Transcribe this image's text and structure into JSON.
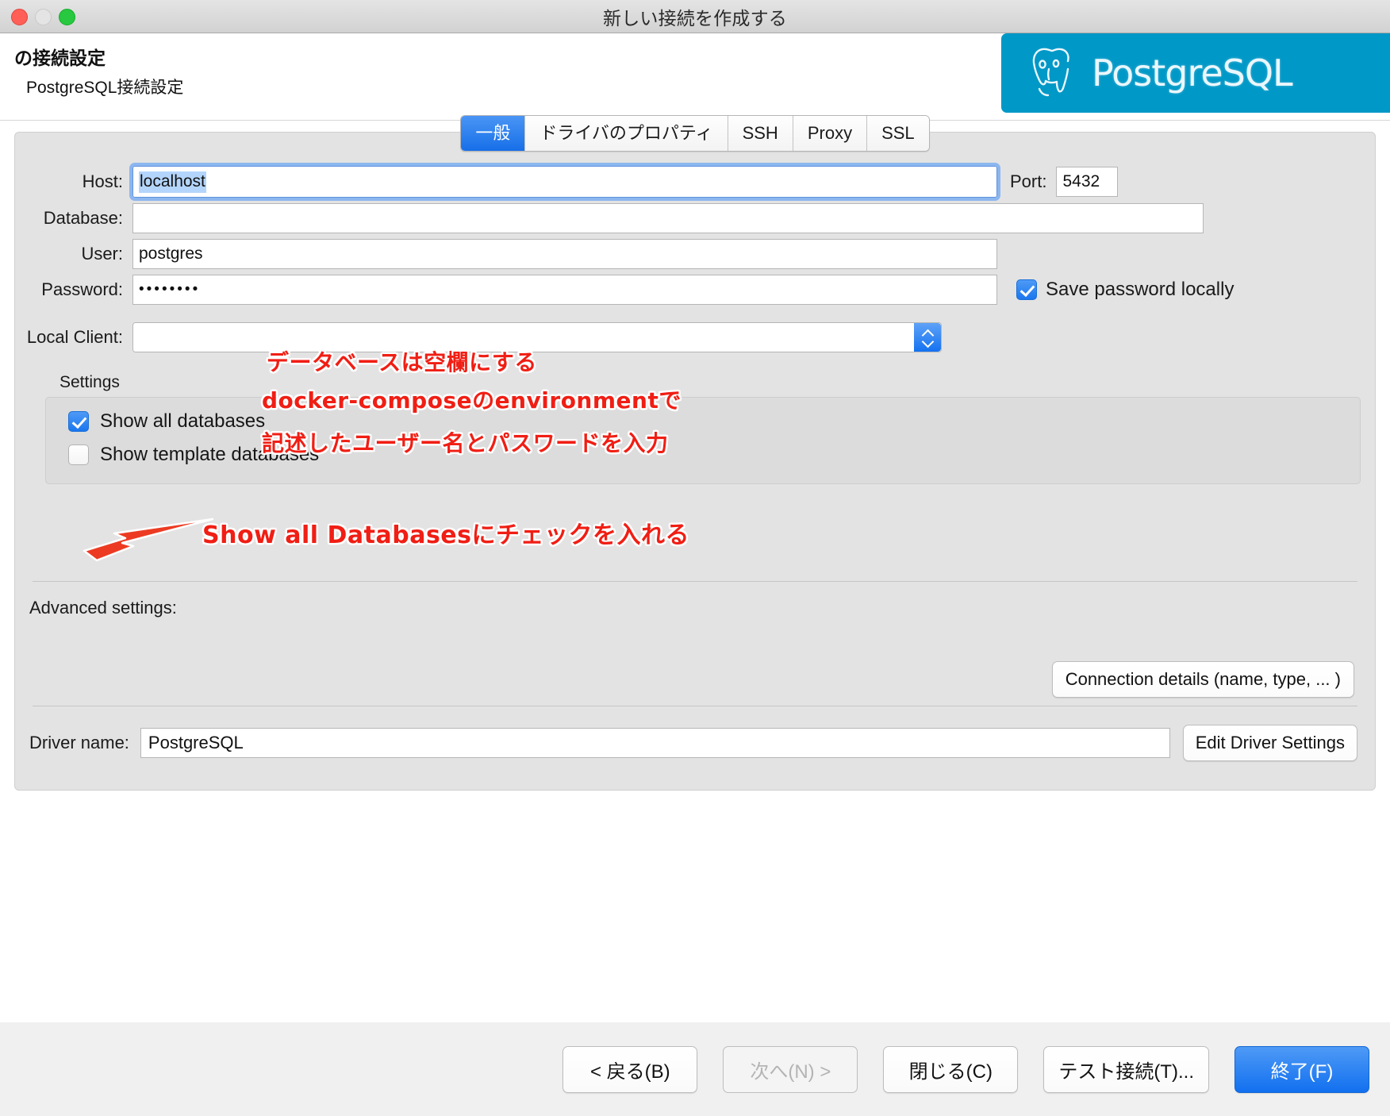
{
  "window": {
    "title": "新しい接続を作成する",
    "traffic_lights": [
      "close",
      "minimize",
      "maximize"
    ]
  },
  "header": {
    "title": "の接続設定",
    "subtitle": "PostgreSQL接続設定",
    "brand": "PostgreSQL",
    "brand_color": "#0098c7"
  },
  "tabs": [
    {
      "label": "一般",
      "active": true
    },
    {
      "label": "ドライバのプロパティ",
      "active": false
    },
    {
      "label": "SSH",
      "active": false
    },
    {
      "label": "Proxy",
      "active": false
    },
    {
      "label": "SSL",
      "active": false
    }
  ],
  "form": {
    "host": {
      "label": "Host:",
      "value": "localhost",
      "selected": true
    },
    "port": {
      "label": "Port:",
      "value": "5432"
    },
    "database": {
      "label": "Database:",
      "value": ""
    },
    "user": {
      "label": "User:",
      "value": "postgres"
    },
    "password": {
      "label": "Password:",
      "value": "••••••••"
    },
    "save_password": {
      "label": "Save password locally",
      "checked": true
    },
    "local_client": {
      "label": "Local Client:",
      "value": ""
    }
  },
  "settings": {
    "label": "Settings",
    "checkboxes": [
      {
        "label": "Show all databases",
        "checked": true
      },
      {
        "label": "Show template databases",
        "checked": false
      }
    ]
  },
  "advanced": {
    "label": "Advanced settings:",
    "connection_details_button": "Connection details (name, type, ... )"
  },
  "driver": {
    "label": "Driver name:",
    "value": "PostgreSQL",
    "edit_button": "Edit Driver Settings"
  },
  "footer": {
    "back": "< 戻る(B)",
    "next": "次へ(N) >",
    "close": "閉じる(C)",
    "test": "テスト接続(T)...",
    "finish": "終了(F)"
  },
  "annotations": {
    "color": "#f01e14",
    "database": "データベースは空欄にする",
    "user": "docker-composeのenvironmentで",
    "password": "記述したユーザー名とパスワードを入力",
    "show_all": "Show all Databasesにチェックを入れる"
  }
}
